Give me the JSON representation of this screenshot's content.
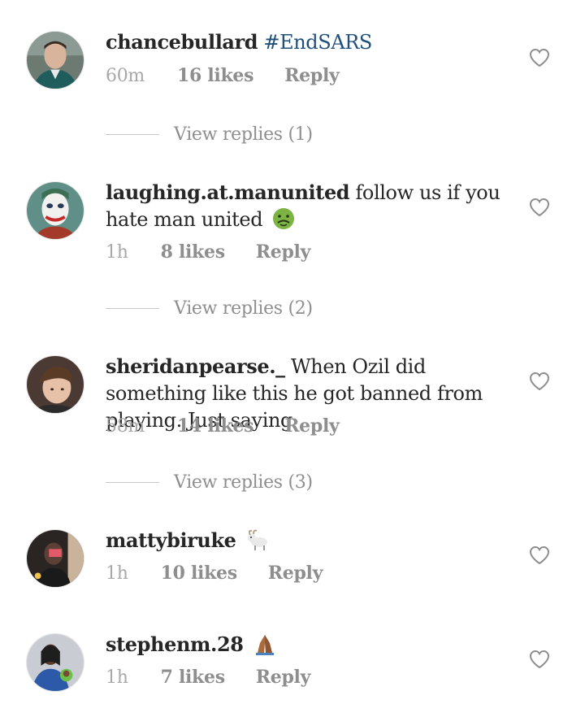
{
  "comments": [
    {
      "username": "chancebullard",
      "text": "",
      "hashtag": "#EndSARS",
      "emoji": "",
      "time": "60m",
      "likes": "16 likes",
      "reply": "Reply",
      "view_replies": "View replies (1)"
    },
    {
      "username": "laughing.at.manunited",
      "text": "follow us if you hate man united",
      "hashtag": "",
      "emoji": "nauseated-face-emoji",
      "time": "1h",
      "likes": "8 likes",
      "reply": "Reply",
      "view_replies": "View replies (2)"
    },
    {
      "username": "sheridanpearse._",
      "text": "When Ozil did something like this he got banned from playing. Just saying",
      "hashtag": "",
      "emoji": "",
      "time": "58m",
      "likes": "14 likes",
      "reply": "Reply",
      "view_replies": "View replies (3)"
    },
    {
      "username": "mattybiruke",
      "text": "",
      "hashtag": "",
      "emoji": "goat-emoji",
      "time": "1h",
      "likes": "10 likes",
      "reply": "Reply",
      "view_replies": ""
    },
    {
      "username": "stephenm.28",
      "text": "",
      "hashtag": "",
      "emoji": "folded-hands-emoji",
      "time": "1h",
      "likes": "7 likes",
      "reply": "Reply",
      "view_replies": ""
    }
  ],
  "colors": {
    "text": "#262626",
    "muted": "#8e8e8e",
    "hashtag": "#1f4f7a",
    "divider": "#c7c7c7"
  }
}
